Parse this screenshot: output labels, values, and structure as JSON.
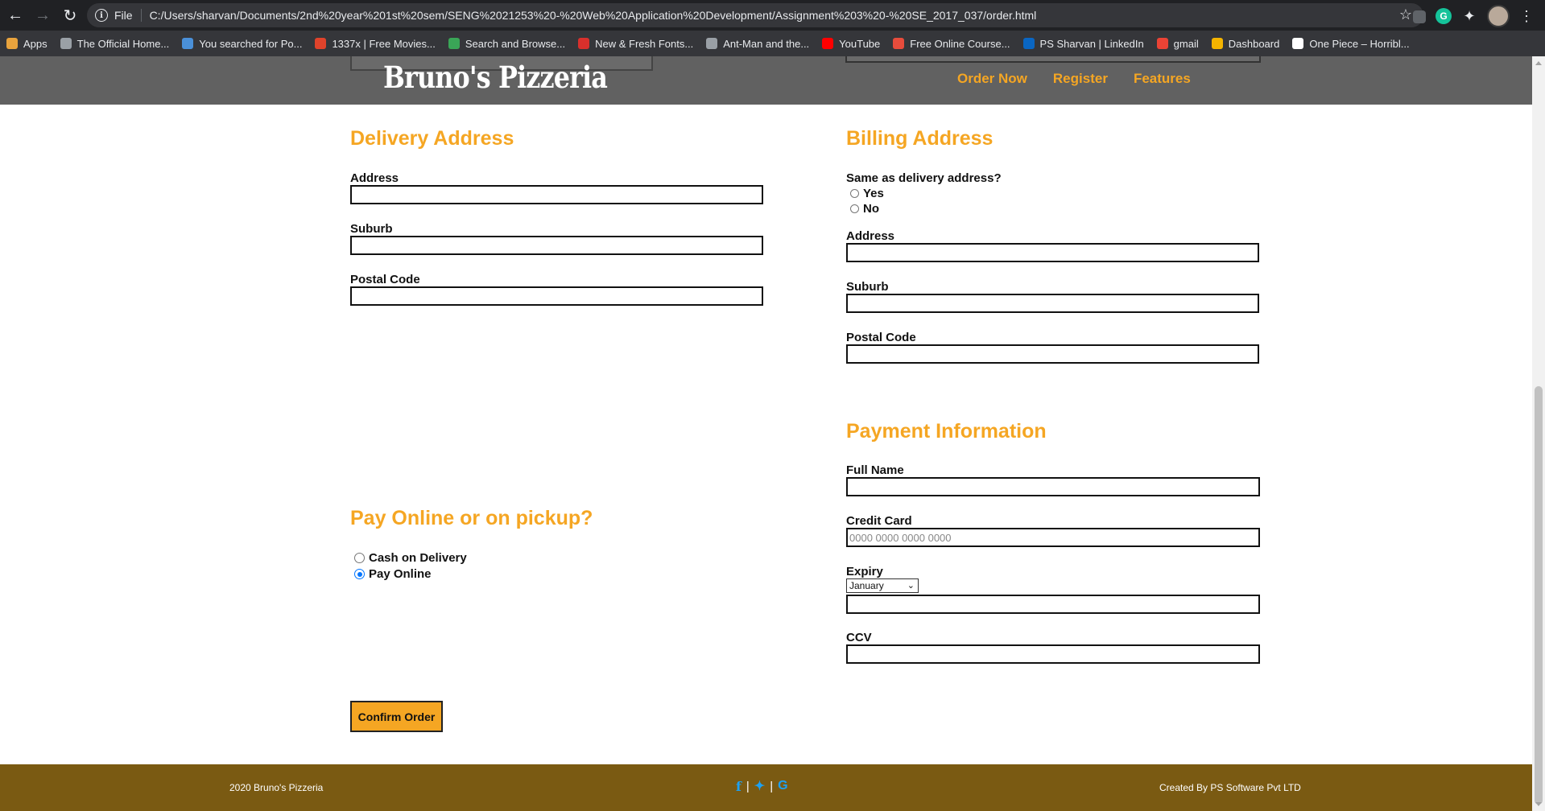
{
  "browser": {
    "scheme": "File",
    "url": "C:/Users/sharvan/Documents/2nd%20year%201st%20sem/SENG%2021253%20-%20Web%20Application%20Development/Assignment%203%20-%20SE_2017_037/order.html",
    "bookmarks": [
      {
        "label": "Apps",
        "icon": "apps-grid-icon",
        "color": "#e8a33d"
      },
      {
        "label": "The Official Home...",
        "icon": "globe-icon",
        "color": "#9aa0a6"
      },
      {
        "label": "You searched for Po...",
        "icon": "bolt-icon",
        "color": "#4a90d9"
      },
      {
        "label": "1337x | Free Movies...",
        "icon": "x-icon",
        "color": "#e0432b"
      },
      {
        "label": "Search and Browse...",
        "icon": "leaf-icon",
        "color": "#3aa657"
      },
      {
        "label": "New & Fresh Fonts...",
        "icon": "f-icon",
        "color": "#d9302c"
      },
      {
        "label": "Ant-Man and the...",
        "icon": "globe-icon",
        "color": "#9aa0a6"
      },
      {
        "label": "YouTube",
        "icon": "youtube-icon",
        "color": "#ff0000"
      },
      {
        "label": "Free Online Course...",
        "icon": "course-icon",
        "color": "#e74c3c"
      },
      {
        "label": "PS Sharvan | LinkedIn",
        "icon": "linkedin-icon",
        "color": "#0a66c2"
      },
      {
        "label": "gmail",
        "icon": "gmail-icon",
        "color": "#ea4335"
      },
      {
        "label": "Dashboard",
        "icon": "dashboard-icon",
        "color": "#f4b400"
      },
      {
        "label": "One Piece – Horribl...",
        "icon": "page-icon",
        "color": "#ffffff"
      }
    ]
  },
  "header": {
    "logo": "Bruno's Pizzeria",
    "nav": [
      "Order Now",
      "Register",
      "Features"
    ]
  },
  "delivery": {
    "title": "Delivery Address",
    "address_label": "Address",
    "suburb_label": "Suburb",
    "postal_label": "Postal Code"
  },
  "billing": {
    "title": "Billing Address",
    "same_question": "Same as delivery address?",
    "yes": "Yes",
    "no": "No",
    "address_label": "Address",
    "suburb_label": "Suburb",
    "postal_label": "Postal Code"
  },
  "payment_method": {
    "title": "Pay Online or on pickup?",
    "cash": "Cash on Delivery",
    "online": "Pay Online",
    "selected": "online"
  },
  "payment_info": {
    "title": "Payment Information",
    "fullname_label": "Full Name",
    "cc_label": "Credit Card",
    "cc_placeholder": "0000 0000 0000 0000",
    "expiry_label": "Expiry",
    "expiry_month": "January",
    "ccv_label": "CCV"
  },
  "confirm_label": "Confirm Order",
  "footer": {
    "copyright": "2020 Bruno's Pizzeria",
    "credit": "Created By PS Software Pvt LTD",
    "divider": "|"
  },
  "colors": {
    "accent": "#f5a623",
    "header_bg": "#616161",
    "footer_bg": "#7a5a12",
    "social": "#1da1f2"
  }
}
